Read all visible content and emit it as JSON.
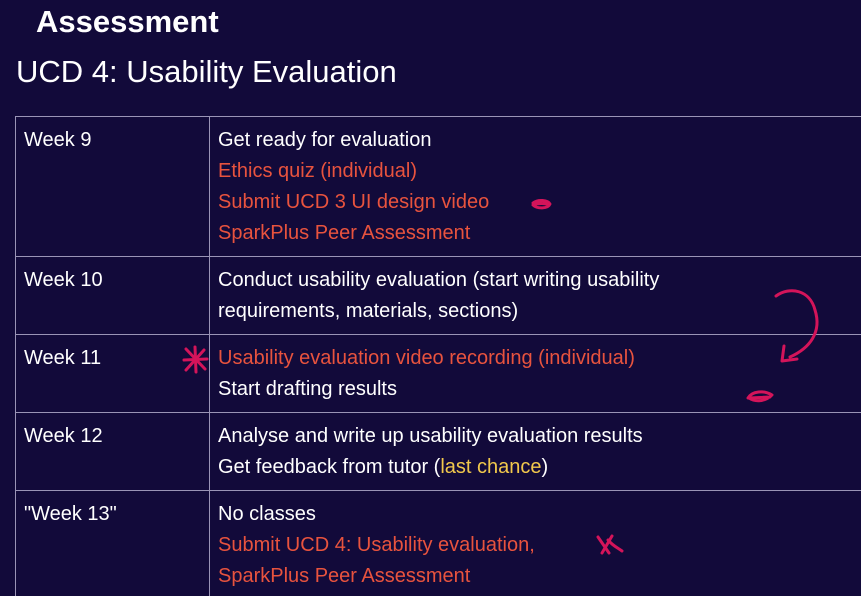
{
  "header": {
    "section_label": "Assessment",
    "title": "UCD 4: Usability Evaluation"
  },
  "schedule": [
    {
      "week": "Week 9",
      "lines": [
        {
          "segments": [
            {
              "text": "Get ready for evaluation",
              "style": "plain"
            }
          ]
        },
        {
          "segments": [
            {
              "text": "Ethics quiz (individual)",
              "style": "red"
            }
          ]
        },
        {
          "segments": [
            {
              "text": "Submit UCD 3 UI design video",
              "style": "red"
            }
          ]
        },
        {
          "segments": [
            {
              "text": "SparkPlus Peer Assessment",
              "style": "red"
            }
          ]
        }
      ]
    },
    {
      "week": "Week 10",
      "lines": [
        {
          "segments": [
            {
              "text": "Conduct usability evaluation (start writing usability",
              "style": "plain"
            }
          ]
        },
        {
          "segments": [
            {
              "text": "requirements, materials, sections)",
              "style": "plain"
            }
          ]
        }
      ]
    },
    {
      "week": "Week 11",
      "lines": [
        {
          "segments": [
            {
              "text": "Usability evaluation video recording (individual)",
              "style": "red"
            }
          ]
        },
        {
          "segments": [
            {
              "text": "Start drafting results",
              "style": "plain"
            }
          ]
        }
      ]
    },
    {
      "week": "Week 12",
      "lines": [
        {
          "segments": [
            {
              "text": "Analyse and write up usability evaluation results",
              "style": "plain"
            }
          ]
        },
        {
          "segments": [
            {
              "text": "Get feedback from tutor (",
              "style": "plain"
            },
            {
              "text": "last chance",
              "style": "yellow"
            },
            {
              "text": ")",
              "style": "plain"
            }
          ]
        }
      ]
    },
    {
      "week": "\"Week 13\"",
      "lines": [
        {
          "segments": [
            {
              "text": "No classes",
              "style": "plain"
            }
          ]
        },
        {
          "segments": [
            {
              "text": "Submit UCD 4: Usability evaluation,",
              "style": "red"
            }
          ]
        },
        {
          "segments": [
            {
              "text": "SparkPlus Peer Assessment",
              "style": "red"
            }
          ]
        }
      ]
    }
  ],
  "colors": {
    "background": "#120a3a",
    "text": "#ffffff",
    "highlight_red": "#e8533e",
    "highlight_yellow": "#f2c94c",
    "annotation_ink": "#d4145a",
    "table_border": "#9a94b6"
  }
}
